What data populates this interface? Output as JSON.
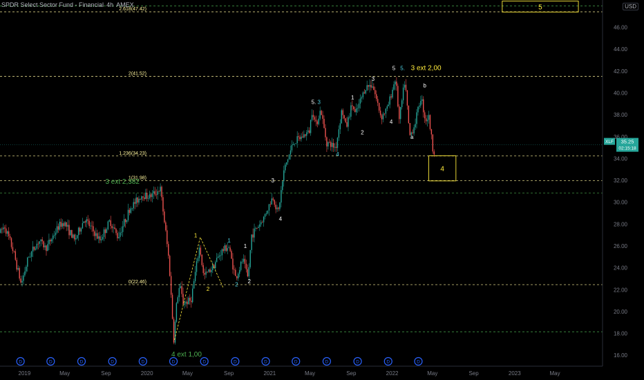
{
  "header": {
    "title": "SPDR Select Sector Fund - Financial",
    "interval": "4h",
    "exchange": "AMEX"
  },
  "currency": "USD",
  "price_tag": {
    "symbol": "XLF",
    "price": "35.25",
    "countdown": "02:15:18"
  },
  "colors": {
    "bg": "#000000",
    "axis": "#787b86",
    "up": "#26a69a",
    "down": "#ef5350",
    "fib": "#fff59d",
    "green_line": "#4caf50",
    "wave_white": "#ffffff",
    "wave_cyan": "#4dd0e1",
    "wave_yellow": "#ffeb3b",
    "wave_green": "#4caf50",
    "dividend": "#2962ff"
  },
  "chart_data": {
    "type": "candlestick",
    "title": "SPDR Select Sector Fund - Financial, 4h, AMEX",
    "xlabel": "",
    "ylabel": "",
    "x_range": [
      "2018-10-20",
      "2023-09-20"
    ],
    "ylim": [
      15,
      48.5
    ],
    "x_ticks": [
      {
        "date": "2019-01-01",
        "label": "2019"
      },
      {
        "date": "2019-05-01",
        "label": "May"
      },
      {
        "date": "2019-09-01",
        "label": "Sep"
      },
      {
        "date": "2020-01-01",
        "label": "2020"
      },
      {
        "date": "2020-05-01",
        "label": "May"
      },
      {
        "date": "2020-09-01",
        "label": "Sep"
      },
      {
        "date": "2021-01-01",
        "label": "2021"
      },
      {
        "date": "2021-05-01",
        "label": "May"
      },
      {
        "date": "2021-09-01",
        "label": "Sep"
      },
      {
        "date": "2022-01-01",
        "label": "2022"
      },
      {
        "date": "2022-05-01",
        "label": "May"
      },
      {
        "date": "2022-09-01",
        "label": "Sep"
      },
      {
        "date": "2023-01-01",
        "label": "2023"
      },
      {
        "date": "2023-05-01",
        "label": "May"
      }
    ],
    "y_ticks": [
      "16.00",
      "18.00",
      "20.00",
      "22.00",
      "24.00",
      "26.00",
      "28.00",
      "30.00",
      "32.00",
      "34.00",
      "36.00",
      "38.00",
      "40.00",
      "42.00",
      "44.00",
      "46.00"
    ],
    "price_path": [
      [
        "2018-10-20",
        27.2
      ],
      [
        "2018-11-05",
        27.8
      ],
      [
        "2018-12-01",
        25.5
      ],
      [
        "2018-12-24",
        22.5
      ],
      [
        "2019-01-15",
        25.0
      ],
      [
        "2019-02-15",
        26.5
      ],
      [
        "2019-03-08",
        25.8
      ],
      [
        "2019-04-15",
        27.8
      ],
      [
        "2019-05-01",
        28.2
      ],
      [
        "2019-06-01",
        26.5
      ],
      [
        "2019-07-01",
        28.5
      ],
      [
        "2019-08-15",
        26.5
      ],
      [
        "2019-09-15",
        28.3
      ],
      [
        "2019-10-08",
        26.8
      ],
      [
        "2019-11-15",
        29.5
      ],
      [
        "2019-12-20",
        30.7
      ],
      [
        "2020-01-10",
        30.5
      ],
      [
        "2020-02-12",
        31.2
      ],
      [
        "2020-02-27",
        27.5
      ],
      [
        "2020-03-09",
        24.5
      ],
      [
        "2020-03-23",
        17.4
      ],
      [
        "2020-04-01",
        21.0
      ],
      [
        "2020-04-10",
        22.4
      ],
      [
        "2020-04-20",
        20.8
      ],
      [
        "2020-05-13",
        21.0
      ],
      [
        "2020-06-08",
        26.0
      ],
      [
        "2020-06-20",
        23.2
      ],
      [
        "2020-07-15",
        24.0
      ],
      [
        "2020-08-12",
        25.5
      ],
      [
        "2020-09-02",
        26.0
      ],
      [
        "2020-09-24",
        23.0
      ],
      [
        "2020-10-15",
        24.8
      ],
      [
        "2020-10-30",
        23.0
      ],
      [
        "2020-11-10",
        27.0
      ],
      [
        "2020-12-15",
        28.5
      ],
      [
        "2021-01-12",
        30.5
      ],
      [
        "2021-01-28",
        29.0
      ],
      [
        "2021-02-15",
        33.0
      ],
      [
        "2021-03-15",
        35.5
      ],
      [
        "2021-04-01",
        35.8
      ],
      [
        "2021-05-01",
        36.5
      ],
      [
        "2021-05-10",
        38.6
      ],
      [
        "2021-05-20",
        37.0
      ],
      [
        "2021-06-04",
        38.5
      ],
      [
        "2021-06-21",
        35.5
      ],
      [
        "2021-07-19",
        35.0
      ],
      [
        "2021-08-06",
        38.5
      ],
      [
        "2021-08-19",
        36.8
      ],
      [
        "2021-09-05",
        39.0
      ],
      [
        "2021-09-15",
        38.0
      ],
      [
        "2021-10-15",
        40.5
      ],
      [
        "2021-11-05",
        40.8
      ],
      [
        "2021-12-01",
        37.8
      ],
      [
        "2021-12-20",
        38.6
      ],
      [
        "2022-01-13",
        41.4
      ],
      [
        "2022-01-24",
        37.5
      ],
      [
        "2022-02-10",
        41.2
      ],
      [
        "2022-02-24",
        36.0
      ],
      [
        "2022-03-10",
        37.0
      ],
      [
        "2022-03-30",
        39.7
      ],
      [
        "2022-04-12",
        37.5
      ],
      [
        "2022-04-22",
        37.8
      ],
      [
        "2022-05-05",
        34.7
      ]
    ],
    "levels": [
      {
        "label": "2.618(47.42)",
        "price": 47.42,
        "kind": "fib"
      },
      {
        "label": "2(41.52)",
        "price": 41.52,
        "kind": "fib"
      },
      {
        "label": "1.236(34.23)",
        "price": 34.23,
        "kind": "fib"
      },
      {
        "label": "1(31.98)",
        "price": 31.98,
        "kind": "fib"
      },
      {
        "label": "0(22.46)",
        "price": 22.46,
        "kind": "fib"
      },
      {
        "label": "",
        "price": 47.95,
        "kind": "green"
      },
      {
        "label": "",
        "price": 30.85,
        "kind": "green"
      },
      {
        "label": "",
        "price": 18.15,
        "kind": "green"
      }
    ],
    "target_boxes": [
      {
        "label": "5",
        "x0": "2022-11-25",
        "x1": "2023-07-10",
        "y0": 47.4,
        "y1": 48.4
      },
      {
        "label": "4",
        "x0": "2022-04-20",
        "x1": "2022-07-10",
        "y0": 31.95,
        "y1": 34.25
      }
    ],
    "wave_path": [
      [
        "2020-03-23",
        17.4
      ],
      [
        "2020-06-08",
        26.8
      ],
      [
        "2020-08-15",
        22.2
      ]
    ],
    "wave_labels": [
      {
        "text": "3 ext 2,382",
        "date": "2019-10-20",
        "price": 31.7,
        "color": "green"
      },
      {
        "text": "4 ext 1,00",
        "date": "2020-04-28",
        "price": 15.9,
        "color": "green"
      },
      {
        "text": "1",
        "date": "2020-05-25",
        "price": 26.8,
        "color": "yellow"
      },
      {
        "text": "2",
        "date": "2020-07-01",
        "price": 21.9,
        "color": "yellow"
      },
      {
        "text": "1",
        "date": "2020-09-02",
        "price": 26.3,
        "color": "cyan"
      },
      {
        "text": "2",
        "date": "2020-09-24",
        "price": 22.3,
        "color": "cyan"
      },
      {
        "text": "1",
        "date": "2020-10-20",
        "price": 25.8,
        "color": "white"
      },
      {
        "text": "2",
        "date": "2020-11-01",
        "price": 22.6,
        "color": "white"
      },
      {
        "text": "3",
        "date": "2021-01-10",
        "price": 31.8,
        "color": "white"
      },
      {
        "text": "4",
        "date": "2021-02-02",
        "price": 28.3,
        "color": "white"
      },
      {
        "text": "4",
        "date": "2021-07-22",
        "price": 34.2,
        "color": "cyan"
      },
      {
        "text": "5.",
        "date": "2021-05-12",
        "price": 39.0,
        "color": "white"
      },
      {
        "text": "3",
        "date": "2021-05-28",
        "price": 39.0,
        "color": "cyan"
      },
      {
        "text": "1",
        "date": "2021-09-05",
        "price": 39.4,
        "color": "white"
      },
      {
        "text": "2",
        "date": "2021-10-04",
        "price": 36.2,
        "color": "white"
      },
      {
        "text": "3",
        "date": "2021-11-05",
        "price": 41.1,
        "color": "white"
      },
      {
        "text": "4",
        "date": "2021-12-29",
        "price": 37.2,
        "color": "white"
      },
      {
        "text": "5",
        "date": "2022-01-06",
        "price": 42.1,
        "color": "white"
      },
      {
        "text": "5.",
        "date": "2022-02-01",
        "price": 42.1,
        "color": "cyan"
      },
      {
        "text": "3 ext 2,00",
        "date": "2022-04-12",
        "price": 42.1,
        "color": "yellow"
      },
      {
        "text": "b",
        "date": "2022-04-08",
        "price": 40.5,
        "color": "white"
      },
      {
        "text": "a",
        "date": "2022-03-01",
        "price": 35.8,
        "color": "white"
      }
    ],
    "dividends": [
      "2018-12-20",
      "2019-03-20",
      "2019-06-20",
      "2019-09-20",
      "2019-12-20",
      "2020-03-20",
      "2020-06-20",
      "2020-09-20",
      "2020-12-20",
      "2021-03-20",
      "2021-06-20",
      "2021-09-20",
      "2021-12-20",
      "2022-03-20"
    ],
    "dividend_marker": "D",
    "current_price": 35.25
  }
}
